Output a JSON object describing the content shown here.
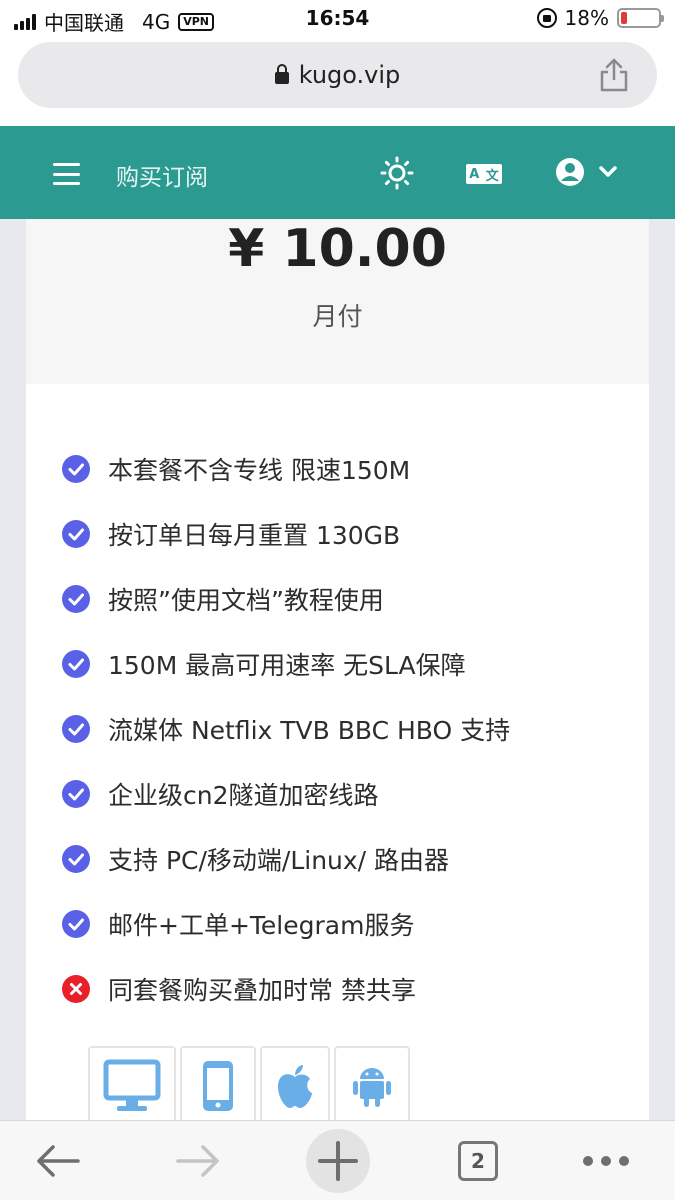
{
  "status_bar": {
    "carrier": "中国联通",
    "network": "4G",
    "vpn": "VPN",
    "time": "16:54",
    "battery": "18%",
    "battery_level": 0.18
  },
  "browser": {
    "url": "kugo.vip",
    "tab_count": "2"
  },
  "header": {
    "title": "购买订阅"
  },
  "plan": {
    "price": "¥ 10.00",
    "period": "月付",
    "features": [
      {
        "text": "本套餐不含专线 限速150M",
        "included": true
      },
      {
        "text": "按订单日每月重置 130GB",
        "included": true
      },
      {
        "text": "按照”使用文档”教程使用",
        "included": true
      },
      {
        "text": "150M 最高可用速率 无SLA保障",
        "included": true
      },
      {
        "text": "流媒体 Netflix TVB BBC HBO 支持",
        "included": true
      },
      {
        "text": "企业级cn2隧道加密线路",
        "included": true
      },
      {
        "text": "支持 PC/移动端/Linux/ 路由器",
        "included": true
      },
      {
        "text": "邮件+工单+Telegram服务",
        "included": true
      },
      {
        "text": "同套餐购买叠加时常 禁共享",
        "included": false
      }
    ],
    "platforms": [
      "desktop-icon",
      "mobile-icon",
      "apple-icon",
      "android-icon"
    ]
  },
  "colors": {
    "header_bg": "#2b9a91",
    "check": "#5b61e6",
    "cross": "#e8202a",
    "platform_icon": "#6aaee8"
  }
}
